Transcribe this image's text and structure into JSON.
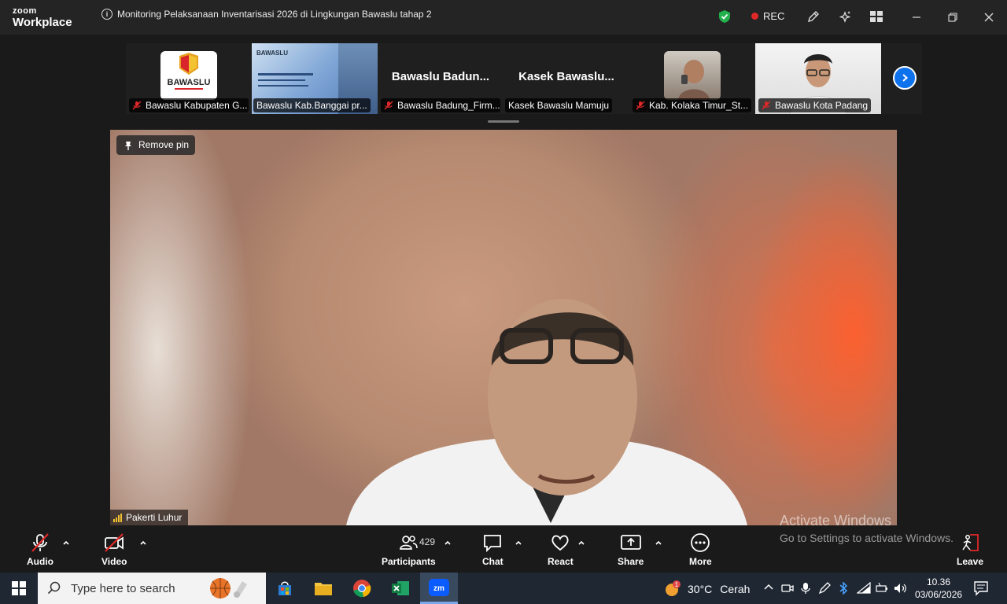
{
  "app": {
    "brand_small": "zoom",
    "brand_large": "Workplace"
  },
  "meeting": {
    "title": "Monitoring Pelaksanaan Inventarisasi 2026 di Lingkungan Bawaslu tahap 2",
    "rec_label": "REC"
  },
  "participants_strip": [
    {
      "name": "Bawaslu Kabupaten G...",
      "muted": true,
      "kind": "logo",
      "logo_text": "BAWASLU"
    },
    {
      "name": "Bawaslu Kab.Banggai pr...",
      "muted": false,
      "kind": "screen",
      "screen_text": "BAWASLU"
    },
    {
      "name": "Bawaslu Badung_Firm...",
      "muted": true,
      "kind": "text",
      "display": "Bawaslu  Badun..."
    },
    {
      "name": "Kasek Bawaslu Mamuju",
      "muted": false,
      "kind": "text",
      "display": "Kasek  Bawaslu..."
    },
    {
      "name": "Kab. Kolaka Timur_St...",
      "muted": true,
      "kind": "avatar"
    },
    {
      "name": "Bawaslu Kota Padang",
      "muted": true,
      "kind": "video"
    }
  ],
  "main_video": {
    "pin_label": "Remove pin",
    "speaker": "Pakerti Luhur",
    "signal_bars": 4
  },
  "toolbar": {
    "audio": "Audio",
    "video": "Video",
    "participants": "Participants",
    "participants_count": "429",
    "chat": "Chat",
    "react": "React",
    "share": "Share",
    "more": "More",
    "leave": "Leave"
  },
  "watermark": {
    "line1": "Activate Windows",
    "line2": "Go to Settings to activate Windows."
  },
  "taskbar": {
    "search_placeholder": "Type here to search",
    "weather_temp": "30°C",
    "weather_desc": "Cerah",
    "weather_badge": "1",
    "time": "10.36",
    "date": "03/06/2026"
  }
}
